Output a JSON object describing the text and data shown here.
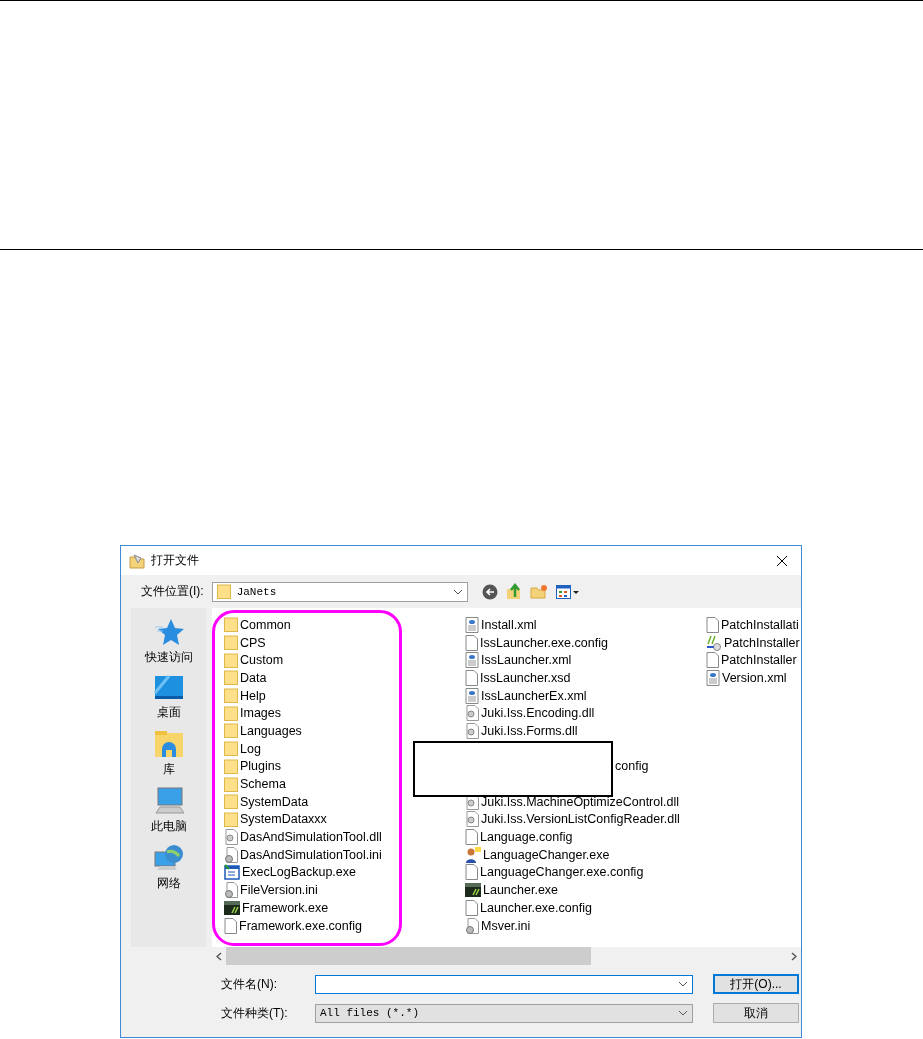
{
  "dialog": {
    "title": "打开文件",
    "location_label": "文件位置(I):",
    "location": "JaNets",
    "toolbar": [
      {
        "kind": "back"
      },
      {
        "kind": "up"
      },
      {
        "kind": "newfolder"
      },
      {
        "kind": "view"
      }
    ],
    "places": [
      {
        "kind": "star",
        "label": "快速访问"
      },
      {
        "kind": "desktop",
        "label": "桌面"
      },
      {
        "kind": "library",
        "label": "库"
      },
      {
        "kind": "computer",
        "label": "此电脑"
      },
      {
        "kind": "network",
        "label": "网络"
      }
    ],
    "columns": [
      {
        "items": [
          {
            "kind": "folder",
            "name": "Common"
          },
          {
            "kind": "folder",
            "name": "CPS"
          },
          {
            "kind": "folder",
            "name": "Custom"
          },
          {
            "kind": "folder",
            "name": "Data"
          },
          {
            "kind": "folder",
            "name": "Help"
          },
          {
            "kind": "folder",
            "name": "Images"
          },
          {
            "kind": "folder",
            "name": "Languages"
          },
          {
            "kind": "folder",
            "name": "Log"
          },
          {
            "kind": "folder",
            "name": "Plugins"
          },
          {
            "kind": "folder",
            "name": "Schema"
          },
          {
            "kind": "folder",
            "name": "SystemData"
          },
          {
            "kind": "folder",
            "name": "SystemDataxxx"
          },
          {
            "kind": "dll",
            "name": "DasAndSimulationTool.dll"
          },
          {
            "kind": "ini",
            "name": "DasAndSimulationTool.ini"
          },
          {
            "kind": "app",
            "name": "ExecLogBackup.exe"
          },
          {
            "kind": "ini",
            "name": "FileVersion.ini"
          },
          {
            "kind": "framework",
            "name": "Framework.exe"
          },
          {
            "kind": "doc",
            "name": "Framework.exe.config"
          }
        ]
      },
      {
        "items": [
          {
            "kind": "xml",
            "name": "Install.xml"
          },
          {
            "kind": "doc",
            "name": "IssLauncher.exe.config"
          },
          {
            "kind": "xml",
            "name": "IssLauncher.xml"
          },
          {
            "kind": "doc",
            "name": "IssLauncher.xsd"
          },
          {
            "kind": "xml",
            "name": "IssLauncherEx.xml"
          },
          {
            "kind": "dll",
            "name": "Juki.Iss.Encoding.dll"
          },
          {
            "kind": "dll",
            "name": "Juki.Iss.Forms.dll"
          },
          {
            "kind": "covered"
          },
          {
            "kind": "covered",
            "tail": "config"
          },
          {
            "kind": "covered"
          },
          {
            "kind": "dll",
            "name": "Juki.Iss.MachineOptimizeControl.dll"
          },
          {
            "kind": "dll",
            "name": "Juki.Iss.VersionListConfigReader.dll"
          },
          {
            "kind": "doc",
            "name": "Language.config"
          },
          {
            "kind": "people",
            "name": "LanguageChanger.exe"
          },
          {
            "kind": "doc",
            "name": "LanguageChanger.exe.config"
          },
          {
            "kind": "launcher",
            "name": "Launcher.exe"
          },
          {
            "kind": "doc",
            "name": "Launcher.exe.config"
          },
          {
            "kind": "ini",
            "name": "Msver.ini"
          }
        ]
      },
      {
        "items": [
          {
            "kind": "doc",
            "name": "PatchInstallati"
          },
          {
            "kind": "patch",
            "name": "PatchInstaller"
          },
          {
            "kind": "doc",
            "name": "PatchInstaller"
          },
          {
            "kind": "xml",
            "name": "Version.xml"
          }
        ]
      }
    ],
    "filename": {
      "label": "文件名(N):"
    },
    "filetype": {
      "label": "文件种类(T):",
      "value": "All files (*.*)"
    },
    "buttons": [
      {
        "label": "打开(O)...",
        "default": true
      },
      {
        "label": "取消",
        "default": false
      }
    ]
  }
}
